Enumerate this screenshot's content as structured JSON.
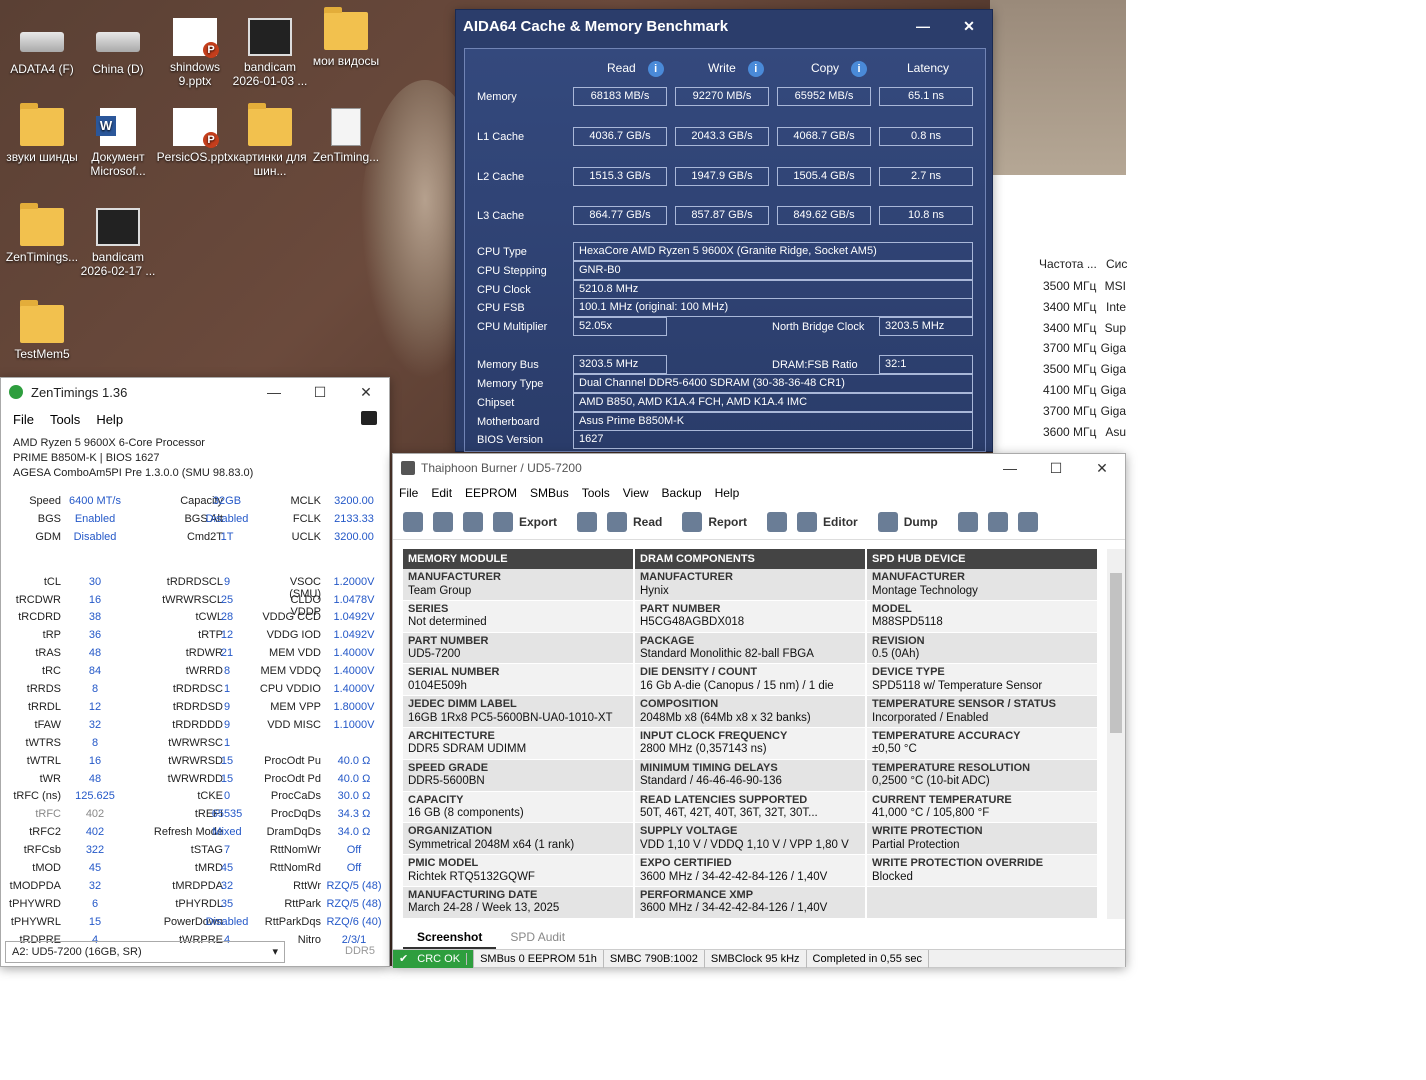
{
  "desktop": {
    "icons": [
      {
        "label": "ADATA4 (F)",
        "kind": "drive"
      },
      {
        "label": "China (D)",
        "kind": "drive"
      },
      {
        "label": "shindows 9.pptx",
        "kind": "ppt"
      },
      {
        "label": "bandicam 2026-01-03 ...",
        "kind": "video"
      },
      {
        "label": "мои видосы",
        "kind": "folder"
      },
      {
        "label": "звуки шинды",
        "kind": "folder"
      },
      {
        "label": "Документ Microsof...",
        "kind": "doc"
      },
      {
        "label": "PersicOS.pptx",
        "kind": "ppt"
      },
      {
        "label": "картинки для шин...",
        "kind": "folder"
      },
      {
        "label": "ZenTiming...",
        "kind": "sheet"
      },
      {
        "label": "ZenTimings...",
        "kind": "folder"
      },
      {
        "label": "bandicam 2026-02-17 ...",
        "kind": "video"
      },
      {
        "label": "TestMem5",
        "kind": "folder"
      }
    ]
  },
  "bg_list": {
    "headers": [
      "Частота ...",
      "Сис"
    ],
    "rows": [
      [
        "3500 МГц",
        "MSI"
      ],
      [
        "3400 МГц",
        "Inte"
      ],
      [
        "3400 МГц",
        "Sup"
      ],
      [
        "3700 МГц",
        "Giga"
      ],
      [
        "3500 МГц",
        "Giga"
      ],
      [
        "4100 МГц",
        "Giga"
      ],
      [
        "3700 МГц",
        "Giga"
      ],
      [
        "3600 МГц",
        "Asu"
      ]
    ]
  },
  "aida": {
    "title": "AIDA64 Cache & Memory Benchmark",
    "cols": [
      "Read",
      "Write",
      "Copy",
      "Latency"
    ],
    "bench": [
      {
        "label": "Memory",
        "values": [
          "68183 MB/s",
          "92270 MB/s",
          "65952 MB/s",
          "65.1 ns"
        ]
      },
      {
        "label": "L1 Cache",
        "values": [
          "4036.7 GB/s",
          "2043.3 GB/s",
          "4068.7 GB/s",
          "0.8 ns"
        ]
      },
      {
        "label": "L2 Cache",
        "values": [
          "1515.3 GB/s",
          "1947.9 GB/s",
          "1505.4 GB/s",
          "2.7 ns"
        ]
      },
      {
        "label": "L3 Cache",
        "values": [
          "864.77 GB/s",
          "857.87 GB/s",
          "849.62 GB/s",
          "10.8 ns"
        ]
      }
    ],
    "cpu_type_label": "CPU Type",
    "cpu_type": "HexaCore AMD Ryzen 5 9600X (Granite Ridge, Socket AM5)",
    "cpu_stepping_label": "CPU Stepping",
    "cpu_stepping": "GNR-B0",
    "cpu_clock_label": "CPU Clock",
    "cpu_clock": "5210.8 MHz",
    "cpu_fsb_label": "CPU FSB",
    "cpu_fsb": "100.1 MHz  (original: 100 MHz)",
    "cpu_mult_label": "CPU Multiplier",
    "cpu_mult": "52.05x",
    "nb_clock_label": "North Bridge Clock",
    "nb_clock": "3203.5 MHz",
    "mem_bus_label": "Memory Bus",
    "mem_bus": "3203.5 MHz",
    "dram_ratio_label": "DRAM:FSB Ratio",
    "dram_ratio": "32:1",
    "mem_type_label": "Memory Type",
    "mem_type": "Dual Channel DDR5-6400 SDRAM  (30-38-36-48 CR1)",
    "chipset_label": "Chipset",
    "chipset": "AMD B850, AMD K1A.4 FCH, AMD K1A.4 IMC",
    "mobo_label": "Motherboard",
    "mobo": "Asus Prime B850M-K",
    "bios_label": "BIOS Version",
    "bios": "1627"
  },
  "zen": {
    "title": "ZenTimings 1.36",
    "menu": [
      "File",
      "Tools",
      "Help"
    ],
    "info": [
      "AMD Ryzen 5 9600X 6-Core Processor",
      "PRIME B850M-K | BIOS 1627",
      "AGESA ComboAm5PI Pre 1.3.0.0 (SMU 98.83.0)"
    ],
    "rows": [
      [
        "Speed",
        "6400 MT/s",
        "Capacity",
        "32GB",
        "MCLK",
        "3200.00"
      ],
      [
        "BGS",
        "Enabled",
        "BGS Alt",
        "Disabled",
        "FCLK",
        "2133.33"
      ],
      [
        "GDM",
        "Disabled",
        "Cmd2T",
        "1T",
        "UCLK",
        "3200.00"
      ],
      [
        "",
        "",
        "",
        "",
        "",
        ""
      ],
      [
        "tCL",
        "30",
        "tRDRDSCL",
        "9",
        "VSOC (SMU)",
        "1.2000V"
      ],
      [
        "tRCDWR",
        "16",
        "tWRWRSCL",
        "25",
        "CLDO VDDP",
        "1.0478V"
      ],
      [
        "tRCDRD",
        "38",
        "tCWL",
        "28",
        "VDDG CCD",
        "1.0492V"
      ],
      [
        "tRP",
        "36",
        "tRTP",
        "12",
        "VDDG IOD",
        "1.0492V"
      ],
      [
        "tRAS",
        "48",
        "tRDWR",
        "21",
        "MEM VDD",
        "1.4000V"
      ],
      [
        "tRC",
        "84",
        "tWRRD",
        "8",
        "MEM VDDQ",
        "1.4000V"
      ],
      [
        "tRRDS",
        "8",
        "tRDRDSC",
        "1",
        "CPU VDDIO",
        "1.4000V"
      ],
      [
        "tRRDL",
        "12",
        "tRDRDSD",
        "9",
        "MEM VPP",
        "1.8000V"
      ],
      [
        "tFAW",
        "32",
        "tRDRDDD",
        "9",
        "VDD MISC",
        "1.1000V"
      ],
      [
        "tWTRS",
        "8",
        "tWRWRSC",
        "1",
        "",
        ""
      ],
      [
        "tWTRL",
        "16",
        "tWRWRSD",
        "15",
        "ProcOdt Pu",
        "40.0 Ω"
      ],
      [
        "tWR",
        "48",
        "tWRWRDD",
        "15",
        "ProcOdt Pd",
        "40.0 Ω"
      ],
      [
        "tRFC (ns)",
        "125.625",
        "tCKE",
        "0",
        "ProcCaDs",
        "30.0 Ω"
      ],
      [
        "tRFC",
        "402",
        "tREFI",
        "65535",
        "ProcDqDs",
        "34.3 Ω"
      ],
      [
        "tRFC2",
        "402",
        "Refresh Mode",
        "Mixed",
        "DramDqDs",
        "34.0 Ω"
      ],
      [
        "tRFCsb",
        "322",
        "tSTAG",
        "7",
        "RttNomWr",
        "Off"
      ],
      [
        "tMOD",
        "45",
        "tMRD",
        "45",
        "RttNomRd",
        "Off"
      ],
      [
        "tMODPDA",
        "32",
        "tMRDPDA",
        "32",
        "RttWr",
        "RZQ/5 (48)"
      ],
      [
        "tPHYWRD",
        "6",
        "tPHYRDL",
        "35",
        "RttPark",
        "RZQ/5 (48)"
      ],
      [
        "tPHYWRL",
        "15",
        "PowerDown",
        "Disabled",
        "RttParkDqs",
        "RZQ/6 (40)"
      ],
      [
        "tRDPRE",
        "4",
        "tWRPRE",
        "4",
        "Nitro",
        "2/3/1"
      ]
    ],
    "dimm": "A2: UD5-7200 (16GB, SR)",
    "ddr": "DDR5"
  },
  "thai": {
    "title": "Thaiphoon Burner / UD5-7200",
    "menu": [
      "File",
      "Edit",
      "EEPROM",
      "SMBus",
      "Tools",
      "View",
      "Backup",
      "Help"
    ],
    "toolbar": {
      "export": "Export",
      "read": "Read",
      "report": "Report",
      "editor": "Editor",
      "dump": "Dump"
    },
    "columns": [
      {
        "head": "MEMORY MODULE",
        "cells": [
          [
            "MANUFACTURER",
            "Team Group"
          ],
          [
            "SERIES",
            "Not determined"
          ],
          [
            "PART NUMBER",
            "UD5-7200"
          ],
          [
            "SERIAL NUMBER",
            "0104E509h"
          ],
          [
            "JEDEC DIMM LABEL",
            "16GB 1Rx8 PC5-5600BN-UA0-1010-XT"
          ],
          [
            "ARCHITECTURE",
            "DDR5 SDRAM UDIMM"
          ],
          [
            "SPEED GRADE",
            "DDR5-5600BN"
          ],
          [
            "CAPACITY",
            "16 GB (8 components)"
          ],
          [
            "ORGANIZATION",
            "Symmetrical 2048M x64 (1 rank)"
          ],
          [
            "PMIC MODEL",
            "Richtek RTQ5132GQWF"
          ],
          [
            "MANUFACTURING DATE",
            "March 24-28 / Week 13, 2025"
          ]
        ]
      },
      {
        "head": "DRAM COMPONENTS",
        "cells": [
          [
            "MANUFACTURER",
            "Hynix"
          ],
          [
            "PART NUMBER",
            "H5CG48AGBDX018"
          ],
          [
            "PACKAGE",
            "Standard Monolithic 82-ball FBGA"
          ],
          [
            "DIE DENSITY / COUNT",
            "16 Gb A-die (Canopus / 15 nm) / 1 die"
          ],
          [
            "COMPOSITION",
            "2048Mb x8 (64Mb x8 x 32 banks)"
          ],
          [
            "INPUT CLOCK FREQUENCY",
            "2800 MHz (0,357143 ns)"
          ],
          [
            "MINIMUM TIMING DELAYS",
            "Standard / 46-46-46-90-136"
          ],
          [
            "READ LATENCIES SUPPORTED",
            "50T, 46T, 42T, 40T, 36T, 32T, 30T..."
          ],
          [
            "SUPPLY VOLTAGE",
            "VDD 1,10 V / VDDQ 1,10 V / VPP 1,80 V"
          ],
          [
            "EXPO CERTIFIED",
            "3600 MHz / 34-42-42-84-126 / 1,40V"
          ],
          [
            "PERFORMANCE XMP",
            "3600 MHz / 34-42-42-84-126 / 1,40V"
          ]
        ]
      },
      {
        "head": "SPD HUB DEVICE",
        "cells": [
          [
            "MANUFACTURER",
            "Montage Technology"
          ],
          [
            "MODEL",
            "M88SPD5118"
          ],
          [
            "REVISION",
            "0.5 (0Ah)"
          ],
          [
            "DEVICE TYPE",
            "SPD5118 w/ Temperature Sensor"
          ],
          [
            "TEMPERATURE SENSOR / STATUS",
            "Incorporated / Enabled"
          ],
          [
            "TEMPERATURE ACCURACY",
            "±0,50 °C"
          ],
          [
            "TEMPERATURE RESOLUTION",
            "0,2500 °C (10-bit ADC)"
          ],
          [
            "CURRENT TEMPERATURE",
            "41,000 °C / 105,800 °F"
          ],
          [
            "WRITE PROTECTION",
            "Partial Protection"
          ],
          [
            "WRITE PROTECTION OVERRIDE",
            "Blocked"
          ],
          [
            "",
            ""
          ]
        ]
      }
    ],
    "tabs": [
      "Screenshot",
      "SPD Audit"
    ],
    "status": [
      "CRC OK",
      "SMBus 0 EEPROM 51h",
      "SMBC 790B:1002",
      "SMBClock 95 kHz",
      "Completed in 0,55 sec"
    ]
  }
}
